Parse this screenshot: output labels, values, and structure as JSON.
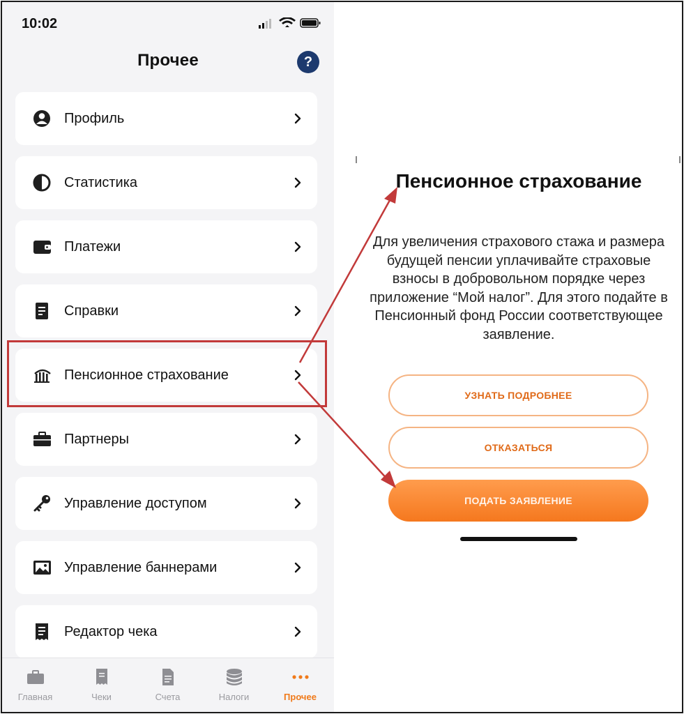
{
  "status": {
    "time": "10:02"
  },
  "header": {
    "title": "Прочее",
    "help_label": "?"
  },
  "menu": [
    {
      "label": "Профиль",
      "icon": "profile-icon"
    },
    {
      "label": "Статистика",
      "icon": "stats-pie-icon"
    },
    {
      "label": "Платежи",
      "icon": "wallet-icon"
    },
    {
      "label": "Справки",
      "icon": "document-icon"
    },
    {
      "label": "Пенсионное страхование",
      "icon": "pension-fund-icon"
    },
    {
      "label": "Партнеры",
      "icon": "briefcase-icon"
    },
    {
      "label": "Управление доступом",
      "icon": "key-icon"
    },
    {
      "label": "Управление баннерами",
      "icon": "image-icon"
    },
    {
      "label": "Редактор чека",
      "icon": "receipt-icon"
    }
  ],
  "tabbar": [
    {
      "label": "Главная",
      "icon": "briefcase-icon",
      "active": false
    },
    {
      "label": "Чеки",
      "icon": "receipt-icon",
      "active": false
    },
    {
      "label": "Счета",
      "icon": "document-icon",
      "active": false
    },
    {
      "label": "Налоги",
      "icon": "coins-icon",
      "active": false
    },
    {
      "label": "Прочее",
      "icon": "more-dots-icon",
      "active": true
    }
  ],
  "pension": {
    "title": "Пенсионное страхование",
    "body": "Для увеличения страхового стажа и размера будущей пенсии уплачивайте страховые взносы в добровольном порядке через приложение “Мой налог”. Для этого подайте в Пенсионный фонд России соответствующее заявление.",
    "learn_more": "УЗНАТЬ ПОДРОБНЕЕ",
    "decline": "ОТКАЗАТЬСЯ",
    "apply": "ПОДАТЬ ЗАЯВЛЕНИЕ"
  },
  "colors": {
    "accent": "#f07a1a",
    "help_button": "#1d3a6e",
    "annotation": "#c23a3a",
    "outline_border": "#f5b483"
  }
}
